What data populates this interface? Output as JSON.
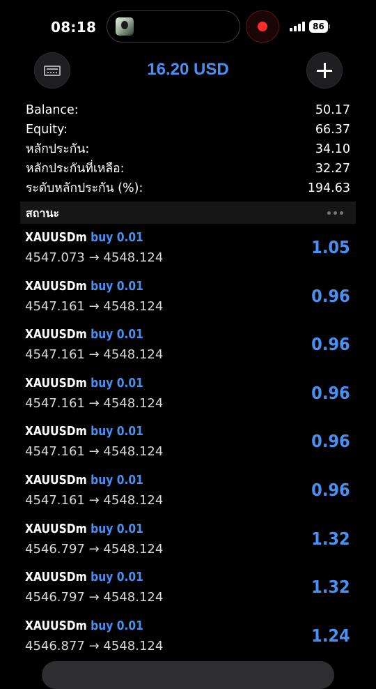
{
  "status_bar": {
    "time": "08:18",
    "battery": "86"
  },
  "header": {
    "title": "16.20 USD",
    "left_icon": "wallet-icon",
    "right_icon": "plus-icon"
  },
  "summary": [
    {
      "label": "Balance:",
      "value": "50.17"
    },
    {
      "label": "Equity:",
      "value": "66.37"
    },
    {
      "label": "หลักประกัน:",
      "value": "34.10"
    },
    {
      "label": "หลักประกันที่เหลือ:",
      "value": "32.27"
    },
    {
      "label": "ระดับหลักประกัน (%):",
      "value": "194.63"
    }
  ],
  "section": {
    "title": "สถานะ",
    "more_icon": "more-horizontal-icon"
  },
  "positions": [
    {
      "symbol": "XAUUSDm",
      "type": "buy 0.01",
      "prices": "4547.073 → 4548.124",
      "profit": "1.05"
    },
    {
      "symbol": "XAUUSDm",
      "type": "buy 0.01",
      "prices": "4547.161 → 4548.124",
      "profit": "0.96"
    },
    {
      "symbol": "XAUUSDm",
      "type": "buy 0.01",
      "prices": "4547.161 → 4548.124",
      "profit": "0.96"
    },
    {
      "symbol": "XAUUSDm",
      "type": "buy 0.01",
      "prices": "4547.161 → 4548.124",
      "profit": "0.96"
    },
    {
      "symbol": "XAUUSDm",
      "type": "buy 0.01",
      "prices": "4547.161 → 4548.124",
      "profit": "0.96"
    },
    {
      "symbol": "XAUUSDm",
      "type": "buy 0.01",
      "prices": "4547.161 → 4548.124",
      "profit": "0.96"
    },
    {
      "symbol": "XAUUSDm",
      "type": "buy 0.01",
      "prices": "4546.797 → 4548.124",
      "profit": "1.32"
    },
    {
      "symbol": "XAUUSDm",
      "type": "buy 0.01",
      "prices": "4546.797 → 4548.124",
      "profit": "1.32"
    },
    {
      "symbol": "XAUUSDm",
      "type": "buy 0.01",
      "prices": "4546.877 → 4548.124",
      "profit": "1.24"
    }
  ],
  "colors": {
    "accent": "#4a8ff2",
    "background": "#000000",
    "recording": "#ff2a2a"
  }
}
